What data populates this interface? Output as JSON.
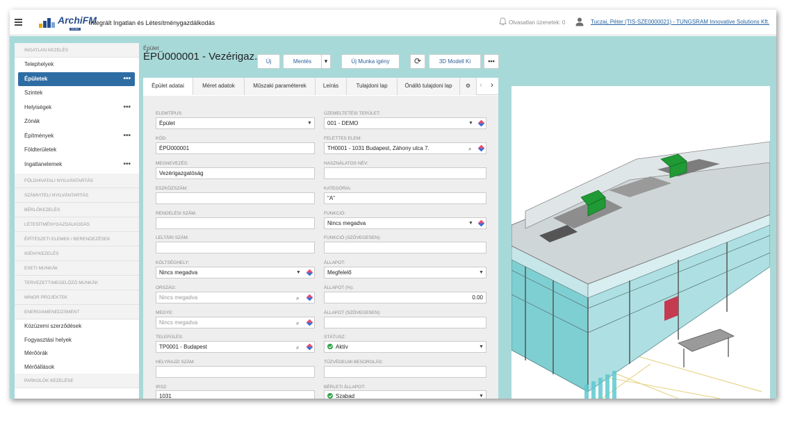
{
  "app": {
    "logo_text": "ArchiFM",
    "logo_sub": "VIKING",
    "title": "Integrált Ingatlan és Létesítménygazdálkodás",
    "notifications": "Olvasatlan üzenetek: 0",
    "user": "Tuczai, Péter (TIS-SZE0000021) - TUNGSRAM Innovative Solutions Kft."
  },
  "sidebar": {
    "section_ingatlan": "Ingatlan kezelés",
    "items": [
      {
        "label": "Telephelyek"
      },
      {
        "label": "Épületek"
      },
      {
        "label": "Szintek"
      },
      {
        "label": "Helyiségek"
      },
      {
        "label": "Zónák"
      },
      {
        "label": "Építmények"
      },
      {
        "label": "Földterületek"
      },
      {
        "label": "Ingatlanelemek"
      }
    ],
    "sections": [
      "Földhivatali nyilvántartás",
      "Számviteli nyilvántartás",
      "Bérlőkezelés",
      "Létesítménygazdálkodás",
      "Építészeti elemek / berendezések",
      "Igénykezelés",
      "Eseti munkák",
      "Tervezett/megelőző munkák",
      "Minor projektek",
      "Energiamenedzsment"
    ],
    "energy_items": [
      {
        "label": "Közüzemi szerződések"
      },
      {
        "label": "Fogyasztási helyek"
      },
      {
        "label": "Mérőórák"
      },
      {
        "label": "Mérőállások"
      }
    ],
    "last_section": "Parkolók kezelése",
    "more": "•••"
  },
  "record": {
    "type": "Épület",
    "title": "ÉPÜ000001 - Vezérigaz..."
  },
  "toolbar": {
    "new": "Új",
    "save": "Mentés",
    "save_caret": "▾",
    "new_work": "Új Munka igény",
    "refresh": "⟳",
    "model3d": "3D Modell Ki",
    "more": "•••"
  },
  "tabs": [
    {
      "label": "Épület adatai"
    },
    {
      "label": "Méret adatok"
    },
    {
      "label": "Műszaki paraméterek"
    },
    {
      "label": "Leírás"
    },
    {
      "label": "Tulajdoni lap"
    },
    {
      "label": "Önálló tulajdoni lap"
    },
    {
      "label": "⚙"
    }
  ],
  "tab_nav": {
    "prev": "‹",
    "next": "›"
  },
  "form": {
    "left": [
      {
        "label": "Elemtípus:",
        "value": "Épület"
      },
      {
        "label": "Kód:",
        "value": "ÉPÜ000001"
      },
      {
        "label": "Megnevezés:",
        "value": "Vezérigazgatóság"
      },
      {
        "label": "Eszközszám:",
        "value": ""
      },
      {
        "label": "Rendelési szám:",
        "value": ""
      },
      {
        "label": "Leltári szám:",
        "value": ""
      },
      {
        "label": "Költséghely:",
        "value": "Nincs megadva"
      },
      {
        "label": "Ország:",
        "value": "Nincs megadva"
      },
      {
        "label": "Megye:",
        "value": "Nincs megadva"
      },
      {
        "label": "Település:",
        "value": "TP0001 - Budapest"
      },
      {
        "label": "Helyrajzi szám:",
        "value": ""
      },
      {
        "label": "Irsz:",
        "value": "1031"
      }
    ],
    "right": [
      {
        "label": "Üzemeltetési terület:",
        "value": "001 - DEMO"
      },
      {
        "label": "Felettes elem:",
        "value": "TH0001 - 1031 Budapest, Záhony utca 7."
      },
      {
        "label": "Használatos név:",
        "value": ""
      },
      {
        "label": "Kategória:",
        "value": "\"A\""
      },
      {
        "label": "Funkció:",
        "value": "Nincs megadva"
      },
      {
        "label": "Funkció (szövegesen):",
        "value": ""
      },
      {
        "label": "Állapot:",
        "value": "Megfelelő"
      },
      {
        "label": "Állapot (%):",
        "value": "0.00"
      },
      {
        "label": "Állapot (szövegesen):",
        "value": ""
      },
      {
        "label": "Státusz:",
        "value": "Aktív"
      },
      {
        "label": "Tűzvédelmi besorolás:",
        "value": ""
      },
      {
        "label": "Bérleti állapot:",
        "value": "Szabad"
      }
    ]
  },
  "colors": {
    "accent": "#2e6da4",
    "background": "#a8d9d9",
    "status_green": "#2fa34b"
  }
}
